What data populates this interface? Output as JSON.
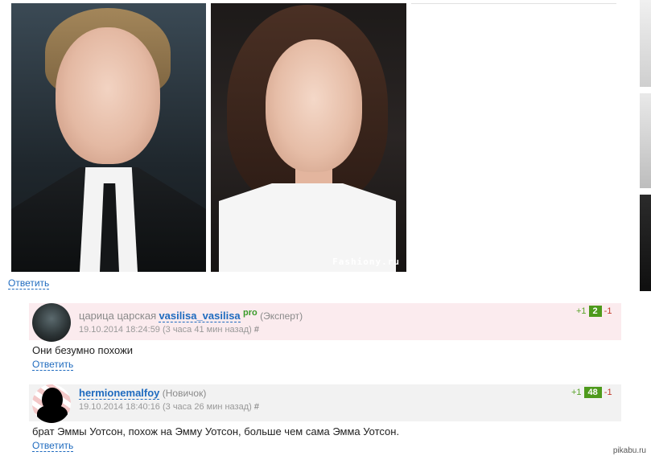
{
  "post": {
    "watermark": "Fashiony.ru",
    "reply_label": "Ответить"
  },
  "comments": [
    {
      "realname": "царица царская",
      "nick": "vasilisa_vasilisa",
      "badge": "pro",
      "rank": "(Эксперт)",
      "date": "19.10.2014 18:24:59 (3 часа 41 мин назад)",
      "hash": "#",
      "plus": "+1",
      "score": "2",
      "minus": "-1",
      "text": "Они безумно похожи",
      "reply_label": "Ответить"
    },
    {
      "nick": "hermionemalfoy",
      "rank": "(Новичок)",
      "date": "19.10.2014 18:40:16 (3 часа 26 мин назад)",
      "hash": "#",
      "plus": "+1",
      "score": "48",
      "minus": "-1",
      "text": "брат Эммы Уотсон, похож на Эмму Уотсон, больше чем сама Эмма Уотсон.",
      "reply_label": "Ответить"
    }
  ],
  "footer": {
    "site": "pikabu.ru"
  }
}
